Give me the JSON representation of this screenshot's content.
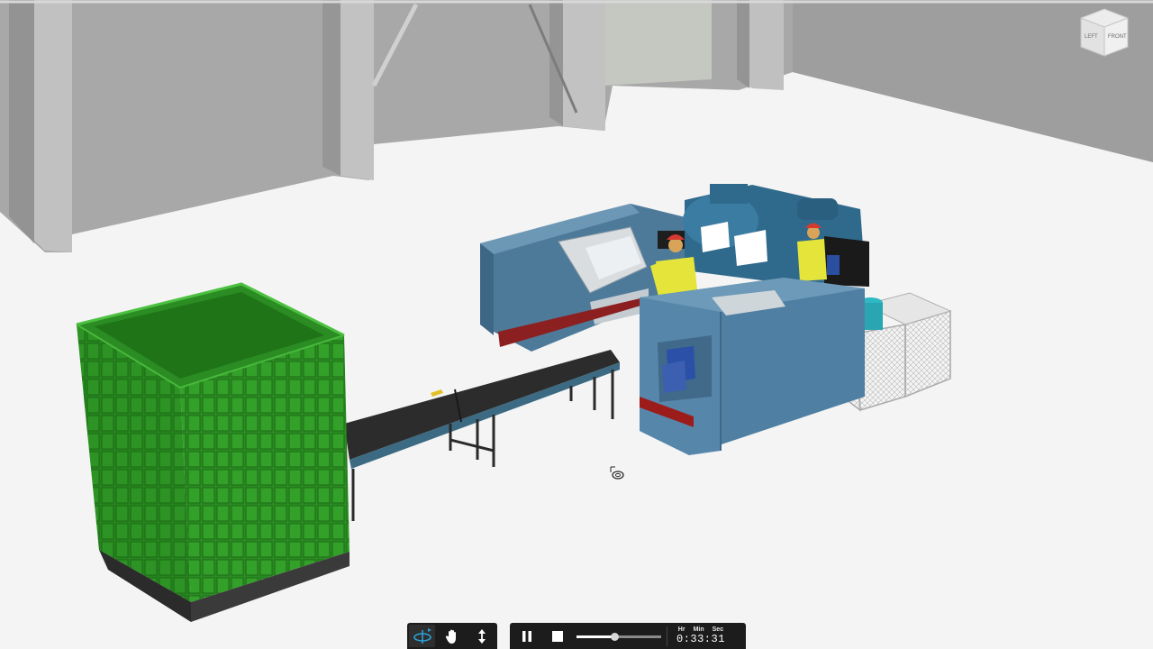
{
  "view_cube": {
    "left_face": "LEFT",
    "front_face": "FRONT"
  },
  "navigation_toolbar": {
    "tools": [
      {
        "name": "orbit",
        "icon": "orbit-icon",
        "active": true
      },
      {
        "name": "pan",
        "icon": "hand-icon",
        "active": false
      },
      {
        "name": "zoom",
        "icon": "zoom-arrows-icon",
        "active": false
      }
    ]
  },
  "playback": {
    "pause_icon": "pause-icon",
    "stop_icon": "stop-icon",
    "progress": 0.45,
    "time_labels": {
      "hours": "Hr",
      "minutes": "Min",
      "seconds": "Sec"
    },
    "time": "0:33:31"
  },
  "colors": {
    "floor": "#f4f4f4",
    "walls": "#a9a9a9",
    "machines": "#4e7a9a",
    "container": "#2a8c22",
    "conveyor_belt": "#2c2c2c",
    "worker_shirt": "#e4e43a",
    "hard_hat": "#d43a30",
    "toolbar": "#1c1c1c",
    "toolbar_accent": "#2aa0d8"
  }
}
